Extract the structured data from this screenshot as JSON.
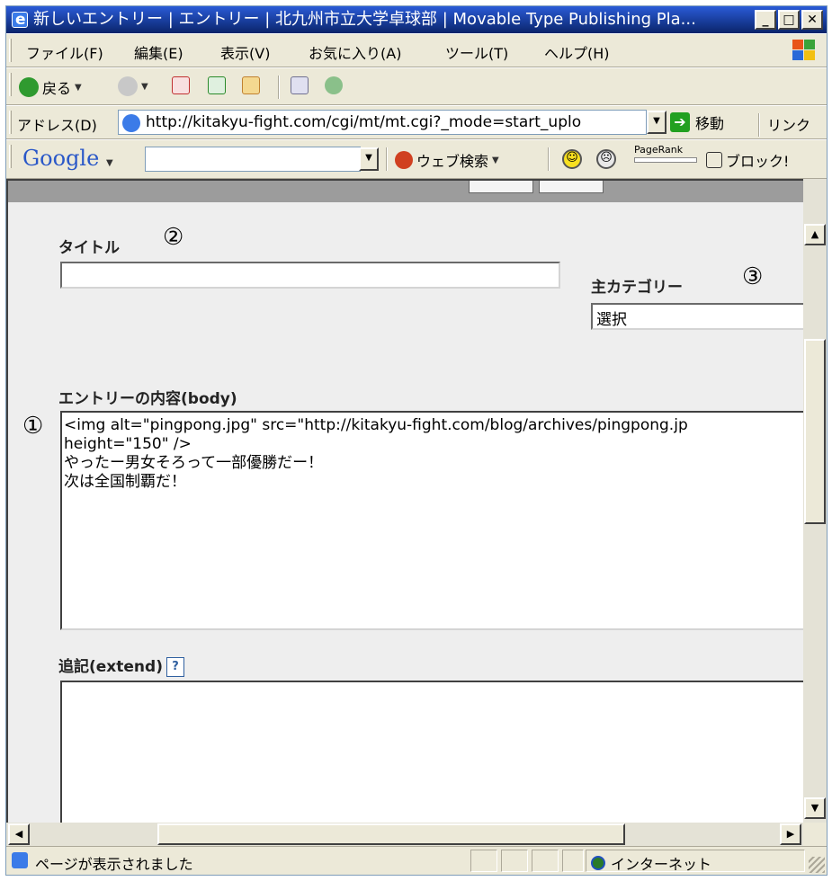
{
  "window": {
    "title": "新しいエントリー | エントリー | 北九州市立大学卓球部 | Movable Type Publishing Pla...",
    "buttons": {
      "minimize": "_",
      "maximize": "□",
      "close": "✕"
    }
  },
  "menubar": {
    "items": [
      "ファイル(F)",
      "編集(E)",
      "表示(V)",
      "お気に入り(A)",
      "ツール(T)",
      "ヘルプ(H)"
    ]
  },
  "toolbar": {
    "back_label": "戻る"
  },
  "addressbar": {
    "label": "アドレス(D)",
    "url": "http://kitakyu-fight.com/cgi/mt/mt.cgi?_mode=start_uplo",
    "go_label": "移動",
    "links_label": "リンク"
  },
  "googlebar": {
    "logo": "Google",
    "search_value": "",
    "web_search_label": "ウェブ検索",
    "pagerank_label": "PageRank",
    "block_label": "ブロック!"
  },
  "form": {
    "title_label": "タイトル",
    "title_value": "",
    "category_label": "主カテゴリー",
    "category_value": "選択",
    "body_label": "エントリーの内容(body)",
    "body_text": "<img alt=\"pingpong.jpg\" src=\"http://kitakyu-fight.com/blog/archives/pingpong.jp\nheight=\"150\" />\nやったー男女そろって一部優勝だー！\n次は全国制覇だ！",
    "extend_label": "追記(extend)",
    "extend_help": "?",
    "extend_value": ""
  },
  "annotations": {
    "mark_body": "①",
    "mark_title": "②",
    "mark_category": "③"
  },
  "statusbar": {
    "text": "ページが表示されました",
    "zone": "インターネット"
  },
  "colors": {
    "titlebar": "#0a246a",
    "chrome": "#ece9d8",
    "content_bg": "#eeeeee"
  }
}
